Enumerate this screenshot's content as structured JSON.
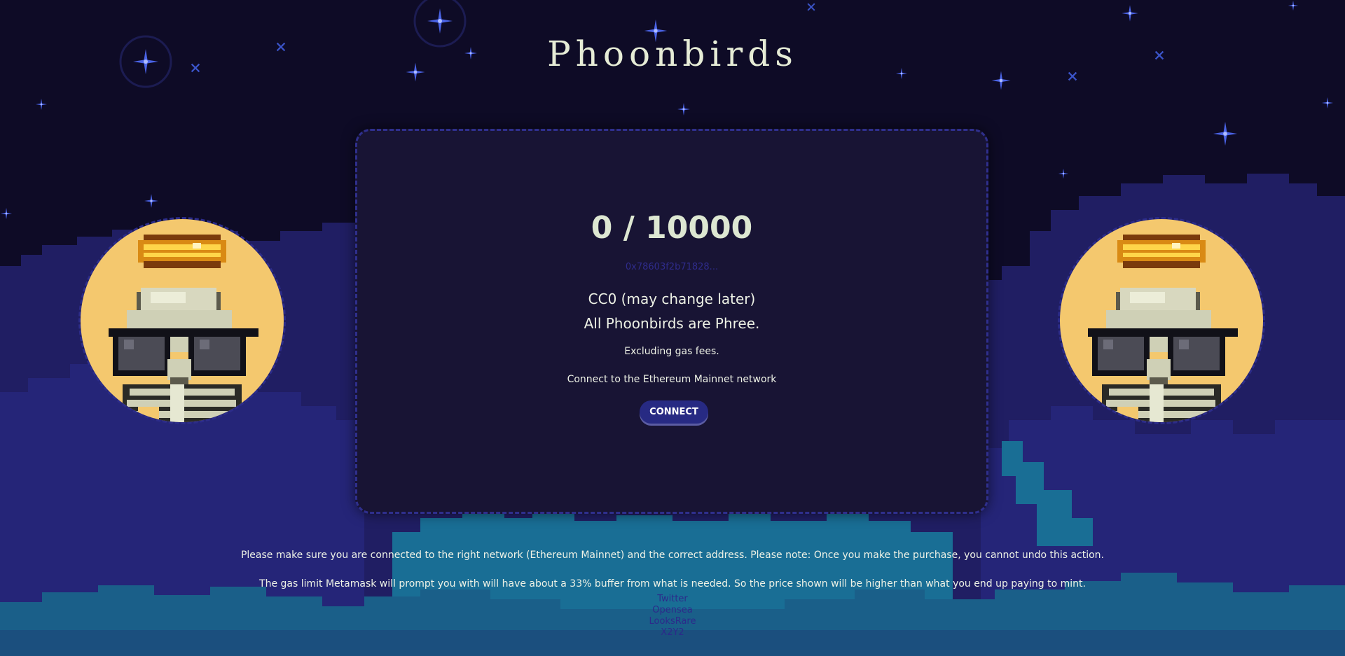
{
  "header": {
    "title": "Phoonbirds"
  },
  "mint_card": {
    "supply_text": "0 / 10000",
    "contract_address": "0x78603f2b71828...",
    "license_text": "CC0 (may change later)",
    "free_text": "All Phoonbirds are Phree.",
    "gas_text": "Excluding gas fees.",
    "network_text": "Connect to the Ethereum Mainnet network",
    "connect_label": "CONNECT"
  },
  "footer": {
    "disclaimer": "Please make sure you are connected to the right network (Ethereum Mainnet) and the correct address. Please note: Once you make the purchase, you cannot undo this action.",
    "gas_limit_note": "The gas limit Metamask will prompt you with will have about a 33% buffer from what is needed. So the price shown will be higher than what you end up paying to mint.",
    "links": [
      "Twitter",
      "Opensea",
      "LooksRare",
      "X2Y2"
    ]
  },
  "colors": {
    "sky": "#0e0b26",
    "card_background": "#181434",
    "card_border": "#2f2f8d",
    "accent_button": "#272a83",
    "avatar_background": "#f4c86e",
    "text": "#eef2e6"
  },
  "icons": {
    "avatar_left": "skeleton-bird-sunglasses-halo-icon",
    "avatar_right": "skeleton-bird-sunglasses-halo-icon",
    "stars": "sparkle-star-icon"
  }
}
